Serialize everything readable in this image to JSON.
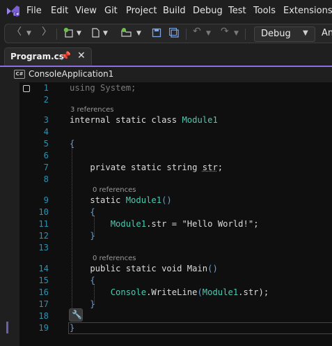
{
  "menubar": {
    "items": [
      "File",
      "Edit",
      "View",
      "Git",
      "Project",
      "Build",
      "Debug",
      "Test",
      "Tools",
      "Extensions"
    ]
  },
  "toolbar": {
    "configuration": "Debug",
    "platform": "Any"
  },
  "tabs": [
    {
      "label": "Program.cs",
      "active": true
    }
  ],
  "navbar": {
    "project_badge": "C#",
    "project": "ConsoleApplication1"
  },
  "editor": {
    "lines": [
      {
        "n": "1",
        "text": "using System;"
      },
      {
        "n": "2",
        "text": ""
      },
      {
        "n": "3",
        "lens": "3 references",
        "text": "internal static class Module1"
      },
      {
        "n": "4",
        "text": ""
      },
      {
        "n": "5",
        "text": "{"
      },
      {
        "n": "6",
        "text": ""
      },
      {
        "n": "7",
        "text": "    private static string str;"
      },
      {
        "n": "8",
        "text": ""
      },
      {
        "n": "9",
        "lens": "0 references",
        "text": "    static Module1()"
      },
      {
        "n": "10",
        "text": "    {"
      },
      {
        "n": "11",
        "text": "        Module1.str = \"Hello World!\";"
      },
      {
        "n": "12",
        "text": "    }"
      },
      {
        "n": "13",
        "text": ""
      },
      {
        "n": "14",
        "lens": "0 references",
        "text": "    public static void Main()"
      },
      {
        "n": "15",
        "text": "    {"
      },
      {
        "n": "16",
        "text": "        Console.WriteLine(Module1.str);"
      },
      {
        "n": "17",
        "text": "    }"
      },
      {
        "n": "18",
        "text": ""
      },
      {
        "n": "19",
        "text": "}"
      }
    ],
    "tokens": {
      "l1_a": "using System;",
      "l3_a": "internal static class ",
      "l3_b": "Module1",
      "l5_a": "{",
      "l7_a": "    private static string ",
      "l7_b": "str",
      "l7_c": ";",
      "l9_a": "    static ",
      "l9_b": "Module1",
      "l9_c": "()",
      "l10_a": "    {",
      "l11_a": "        ",
      "l11_b": "Module1",
      "l11_c": ".str = ",
      "l11_d": "\"Hello World!\"",
      "l11_e": ";",
      "l12_a": "    }",
      "l14_a": "    public static void Main",
      "l14_b": "()",
      "l15_a": "    {",
      "l16_a": "        ",
      "l16_b": "Console",
      "l16_c": ".WriteLine",
      "l16_d": "(",
      "l16_e": "Module1",
      "l16_f": ".str",
      "l16_g": ");",
      "l17_a": "    }",
      "l19_a": "}"
    },
    "lens": {
      "l3": "3 references",
      "l9": "0 references",
      "l14": "0 references"
    }
  },
  "colors": {
    "accent": "#8c6fe0",
    "type": "#4ec9b0",
    "string": "#d69d85",
    "line_number": "#2b91af"
  },
  "icons": [
    "vs-logo-icon",
    "back-icon",
    "forward-icon",
    "new-project-icon",
    "new-file-icon",
    "open-folder-icon",
    "save-icon",
    "save-all-icon",
    "undo-icon",
    "redo-icon",
    "pin-icon",
    "close-icon",
    "csharp-project-icon",
    "lightbulb-icon",
    "fold-icon"
  ]
}
